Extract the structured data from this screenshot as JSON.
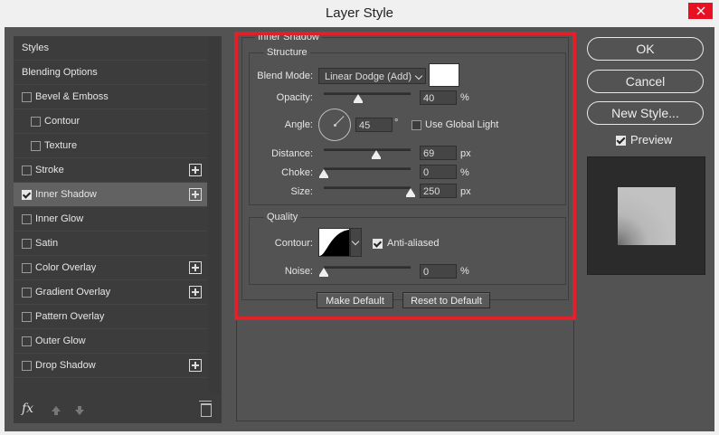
{
  "window": {
    "title": "Layer Style"
  },
  "styles_list": [
    {
      "label": "Styles",
      "checkbox": false,
      "plus": false,
      "indent": false,
      "selected": false,
      "checked": false
    },
    {
      "label": "Blending Options",
      "checkbox": false,
      "plus": false,
      "indent": false,
      "selected": false,
      "checked": false
    },
    {
      "label": "Bevel & Emboss",
      "checkbox": true,
      "plus": false,
      "indent": false,
      "selected": false,
      "checked": false
    },
    {
      "label": "Contour",
      "checkbox": true,
      "plus": false,
      "indent": true,
      "selected": false,
      "checked": false
    },
    {
      "label": "Texture",
      "checkbox": true,
      "plus": false,
      "indent": true,
      "selected": false,
      "checked": false
    },
    {
      "label": "Stroke",
      "checkbox": true,
      "plus": true,
      "indent": false,
      "selected": false,
      "checked": false
    },
    {
      "label": "Inner Shadow",
      "checkbox": true,
      "plus": true,
      "indent": false,
      "selected": true,
      "checked": true
    },
    {
      "label": "Inner Glow",
      "checkbox": true,
      "plus": false,
      "indent": false,
      "selected": false,
      "checked": false
    },
    {
      "label": "Satin",
      "checkbox": true,
      "plus": false,
      "indent": false,
      "selected": false,
      "checked": false
    },
    {
      "label": "Color Overlay",
      "checkbox": true,
      "plus": true,
      "indent": false,
      "selected": false,
      "checked": false
    },
    {
      "label": "Gradient Overlay",
      "checkbox": true,
      "plus": true,
      "indent": false,
      "selected": false,
      "checked": false
    },
    {
      "label": "Pattern Overlay",
      "checkbox": true,
      "plus": false,
      "indent": false,
      "selected": false,
      "checked": false
    },
    {
      "label": "Outer Glow",
      "checkbox": true,
      "plus": false,
      "indent": false,
      "selected": false,
      "checked": false
    },
    {
      "label": "Drop Shadow",
      "checkbox": true,
      "plus": true,
      "indent": false,
      "selected": false,
      "checked": false
    }
  ],
  "bottom_toolbar": {
    "fx_label": "fx"
  },
  "inner_shadow": {
    "title": "Inner Shadow",
    "structure": {
      "title": "Structure",
      "blend_mode_label": "Blend Mode:",
      "blend_mode_value": "Linear Dodge (Add)",
      "blend_color": "#ffffff",
      "opacity_label": "Opacity:",
      "opacity_value": "40",
      "opacity_unit": "%",
      "opacity_level": 0.4,
      "angle_label": "Angle:",
      "angle_value": "45",
      "angle_unit": "°",
      "use_global_light_label": "Use Global Light",
      "use_global_light_checked": false,
      "distance_label": "Distance:",
      "distance_value": "69",
      "distance_unit": "px",
      "distance_level": 0.6,
      "choke_label": "Choke:",
      "choke_value": "0",
      "choke_unit": "%",
      "choke_level": 0.0,
      "size_label": "Size:",
      "size_value": "250",
      "size_unit": "px",
      "size_level": 1.0
    },
    "quality": {
      "title": "Quality",
      "contour_label": "Contour:",
      "anti_aliased_label": "Anti-aliased",
      "anti_aliased_checked": true,
      "noise_label": "Noise:",
      "noise_value": "0",
      "noise_unit": "%",
      "noise_level": 0.0
    },
    "make_default_label": "Make Default",
    "reset_default_label": "Reset to Default"
  },
  "actions": {
    "ok_label": "OK",
    "cancel_label": "Cancel",
    "new_style_label": "New Style...",
    "preview_label": "Preview",
    "preview_checked": true
  },
  "colors": {
    "highlight_box": "#e0202a",
    "panel_bg": "#535353",
    "close_button": "#e81123"
  }
}
